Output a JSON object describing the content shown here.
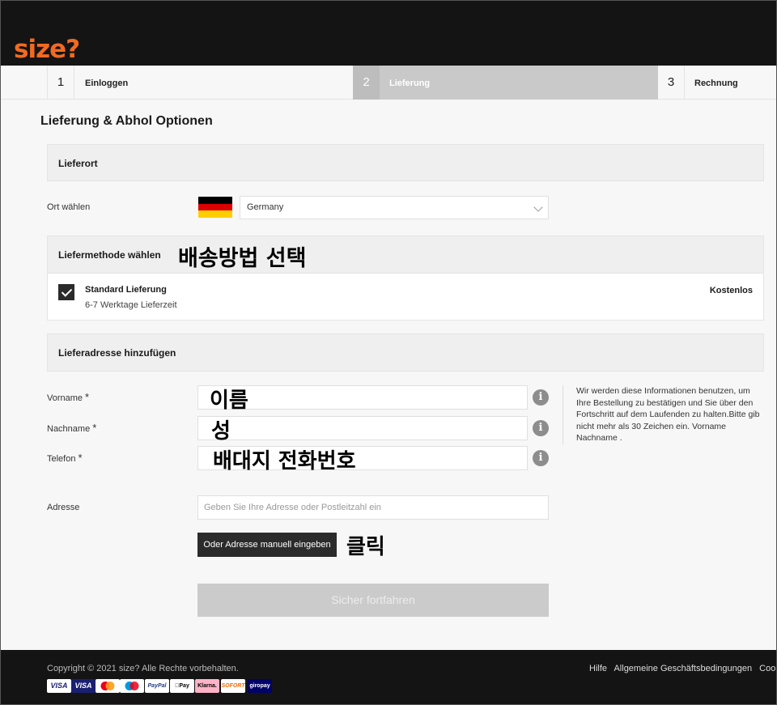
{
  "brand": {
    "logo": "size?",
    "accent": "#f26a21"
  },
  "steps": [
    {
      "num": "1",
      "label": "Einloggen",
      "active": false
    },
    {
      "num": "2",
      "label": "Lieferung",
      "active": true
    },
    {
      "num": "3",
      "label": "Rechnung",
      "active": false
    }
  ],
  "page_title": "Lieferung & Abhol Optionen",
  "location": {
    "heading": "Lieferort",
    "label": "Ort wählen",
    "selected": "Germany",
    "flag_colors": [
      "#000000",
      "#dd0000",
      "#ffce00"
    ]
  },
  "delivery": {
    "heading": "Liefermethode wählen",
    "annotation": "배송방법 선택",
    "option_name": "Standard Lieferung",
    "option_time": "6-7 Werktage Lieferzeit",
    "option_price": "Kostenlos",
    "checked": true
  },
  "address": {
    "heading": "Lieferadresse hinzufügen",
    "required_mark": "*",
    "first_name_label": "Vorname",
    "first_name_annotation": "이름",
    "last_name_label": "Nachname",
    "last_name_annotation": "성",
    "phone_label": "Telefon",
    "phone_annotation": "배대지 전화번호",
    "info_icon": "i",
    "info_note": "Wir werden diese Informationen benutzen, um Ihre Bestellung zu bestätigen und Sie über den Fortschritt auf dem Laufenden zu halten.Bitte gib nicht mehr als 30 Zeichen ein. Vorname Nachname .",
    "address_label": "Adresse",
    "address_placeholder": "Geben Sie Ihre Adresse oder Postleitzahl ein",
    "manual_button": "Oder Adresse manuell eingeben",
    "manual_annotation": "클릭",
    "continue_button": "Sicher fortfahren"
  },
  "footer": {
    "copyright": "Copyright © 2021 size? Alle Rechte vorbehalten.",
    "links": [
      "Hilfe",
      "Allgemeine Geschäftsbedingungen",
      "Cook"
    ],
    "payment_methods": [
      "VISA",
      "VISA",
      "Mastercard",
      "Maestro",
      "PayPal",
      "Apple Pay",
      "Klarna.",
      "SOFORT",
      "giropay"
    ]
  }
}
